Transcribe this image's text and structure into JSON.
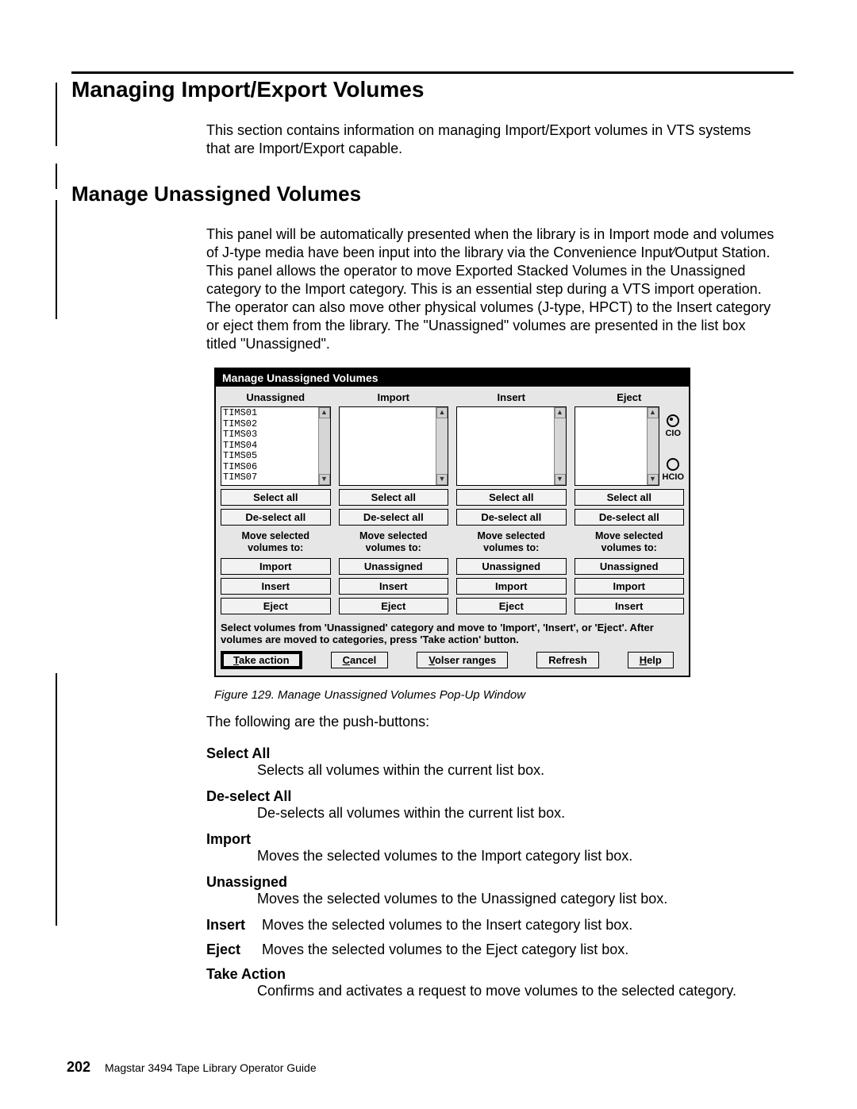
{
  "page": {
    "number": "202",
    "running_footer": "Magstar 3494 Tape Library Operator Guide"
  },
  "headings": {
    "h1": "Managing Import/Export Volumes",
    "h2": "Manage Unassigned Volumes"
  },
  "intro_p1": "This section contains information on managing Import/Export volumes in VTS systems that are Import/Export capable.",
  "intro_p2": "This panel will be automatically presented when the library is in Import mode and volumes of J-type media have been input into the library via the Convenience Input⁄Output Station. This panel allows the operator to move Exported Stacked Volumes in the Unassigned category to the Import category. This is an essential step during a VTS import operation. The operator can also move other physical volumes (J-type, HPCT) to the Insert category or eject them from the library. The \"Unassigned\" volumes are presented in the list box titled \"Unassigned\".",
  "dialog": {
    "title": "Manage Unassigned Volumes",
    "hint": "Select volumes from 'Unassigned' category and move to 'Import', 'Insert', or 'Eject'.  After volumes are moved to categories, press 'Take action' button.",
    "common": {
      "select_all": "Select all",
      "deselect_all": "De-select all",
      "move_label": "Move selected\nvolumes to:"
    },
    "radio": {
      "cio": "CIO",
      "hcio": "HCIO"
    },
    "columns": {
      "unassigned": {
        "head": "Unassigned",
        "items": [
          "TIMS01",
          "TIMS02",
          "TIMS03",
          "TIMS04",
          "TIMS05",
          "TIMS06",
          "TIMS07"
        ],
        "move_buttons": [
          "Import",
          "Insert",
          "Eject"
        ]
      },
      "import": {
        "head": "Import",
        "items": [],
        "move_buttons": [
          "Unassigned",
          "Insert",
          "Eject"
        ]
      },
      "insert": {
        "head": "Insert",
        "items": [],
        "move_buttons": [
          "Unassigned",
          "Import",
          "Eject"
        ]
      },
      "eject": {
        "head": "Eject",
        "items": [],
        "move_buttons": [
          "Unassigned",
          "Import",
          "Insert"
        ]
      }
    },
    "actions": {
      "take_action": "Take action",
      "cancel": "Cancel",
      "volser_ranges": "Volser ranges",
      "refresh": "Refresh",
      "help": "Help"
    }
  },
  "fig_caption": "Figure 129. Manage Unassigned Volumes Pop-Up Window",
  "after_fig_lead": "The following are the push-buttons:",
  "defs": {
    "select_all": {
      "term": "Select All",
      "def": "Selects all volumes within the current list box."
    },
    "deselect_all": {
      "term": "De-select All",
      "def": "De-selects all volumes within the current list box."
    },
    "import": {
      "term": "Import",
      "def": "Moves the selected volumes to the Import category list box."
    },
    "unassigned": {
      "term": "Unassigned",
      "def": "Moves the selected volumes to the Unassigned category list box."
    },
    "insert": {
      "term": "Insert",
      "def": "Moves the selected volumes to the Insert category list box."
    },
    "eject": {
      "term": "Eject",
      "def": "Moves the selected volumes to the Eject category list box."
    },
    "take_action": {
      "term": "Take Action",
      "def": "Confirms and activates a request to move volumes to the selected category."
    }
  }
}
